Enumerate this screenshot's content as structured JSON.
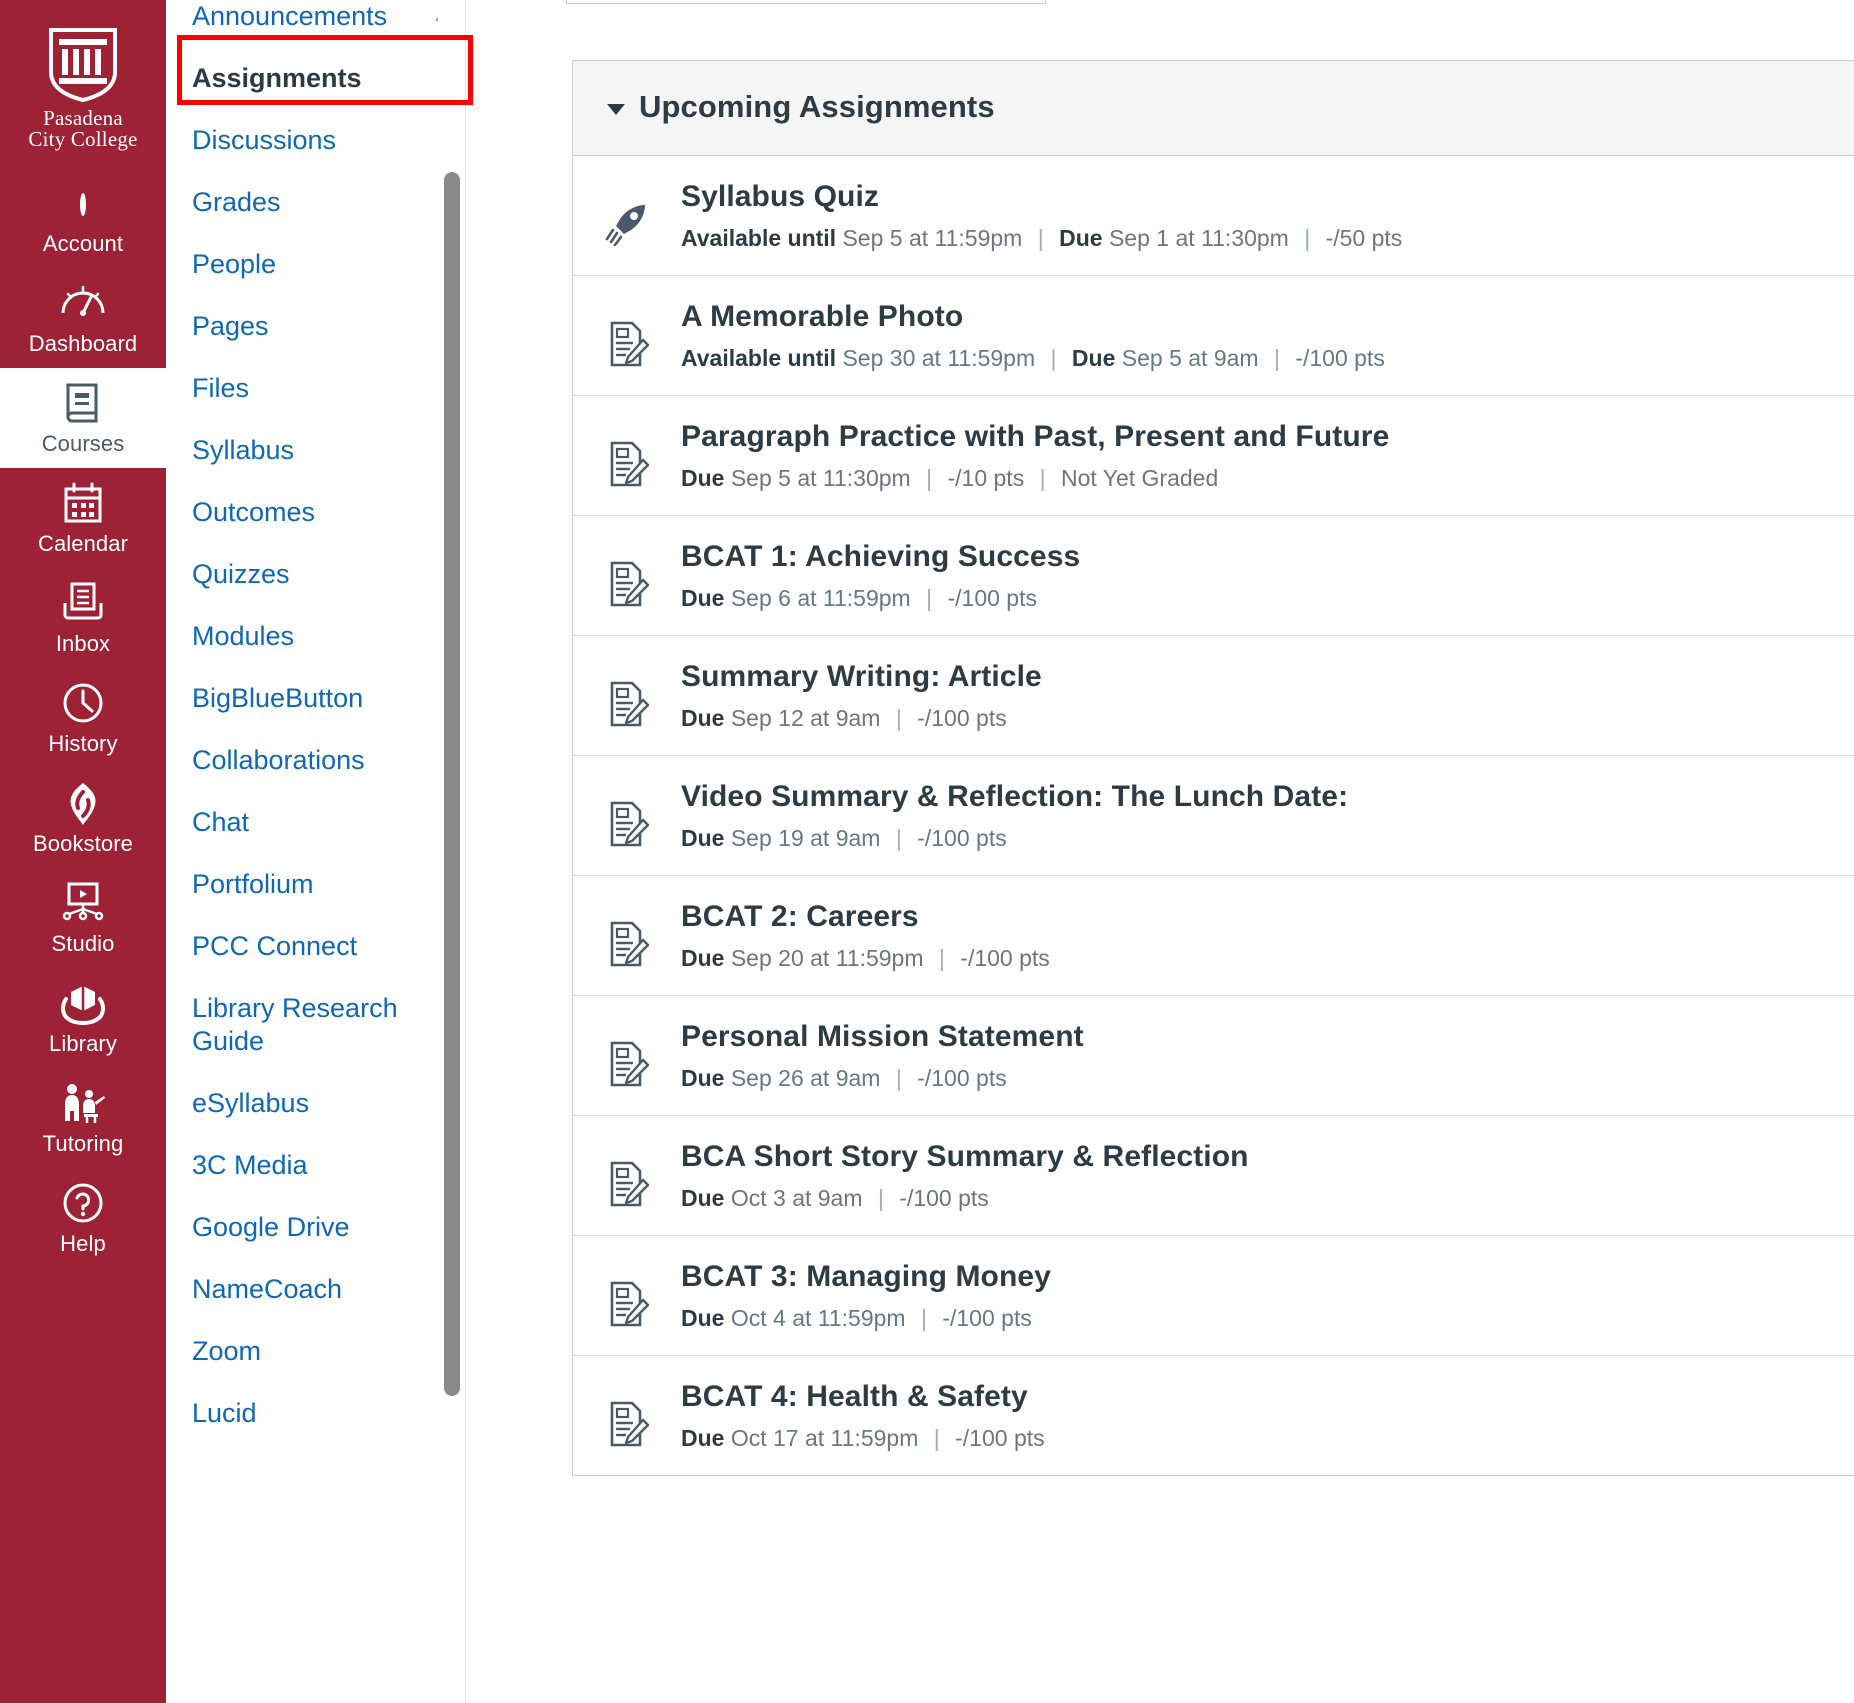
{
  "brand": {
    "logo_icon": "pasadena-city-college-shield-icon",
    "wordmark_line1": "Pasadena",
    "wordmark_line2": "City College"
  },
  "global_nav": {
    "items": [
      {
        "label": "Account",
        "icon": "user-avatar-icon",
        "active": false
      },
      {
        "label": "Dashboard",
        "icon": "dashboard-gauge-icon",
        "active": false
      },
      {
        "label": "Courses",
        "icon": "courses-book-icon",
        "active": true
      },
      {
        "label": "Calendar",
        "icon": "calendar-icon",
        "active": false
      },
      {
        "label": "Inbox",
        "icon": "inbox-tray-icon",
        "active": false
      },
      {
        "label": "History",
        "icon": "clock-history-icon",
        "active": false
      },
      {
        "label": "Bookstore",
        "icon": "bookstore-icon",
        "active": false
      },
      {
        "label": "Studio",
        "icon": "studio-screen-play-icon",
        "active": false
      },
      {
        "label": "Library",
        "icon": "library-hands-book-icon",
        "active": false
      },
      {
        "label": "Tutoring",
        "icon": "tutoring-people-icon",
        "active": false
      },
      {
        "label": "Help",
        "icon": "question-circle-icon",
        "active": false
      }
    ]
  },
  "course_nav": {
    "scroll_up_icon": "chevron-up-icon",
    "items": [
      {
        "label": "Announcements",
        "active": false
      },
      {
        "label": "Assignments",
        "active": true
      },
      {
        "label": "Discussions",
        "active": false
      },
      {
        "label": "Grades",
        "active": false
      },
      {
        "label": "People",
        "active": false
      },
      {
        "label": "Pages",
        "active": false
      },
      {
        "label": "Files",
        "active": false
      },
      {
        "label": "Syllabus",
        "active": false
      },
      {
        "label": "Outcomes",
        "active": false
      },
      {
        "label": "Quizzes",
        "active": false
      },
      {
        "label": "Modules",
        "active": false
      },
      {
        "label": "BigBlueButton",
        "active": false
      },
      {
        "label": "Collaborations",
        "active": false
      },
      {
        "label": "Chat",
        "active": false
      },
      {
        "label": "Portfolium",
        "active": false
      },
      {
        "label": "PCC Connect",
        "active": false
      },
      {
        "label": "Library Research Guide",
        "active": false
      },
      {
        "label": "eSyllabus",
        "active": false
      },
      {
        "label": "3C Media",
        "active": false
      },
      {
        "label": "Google Drive",
        "active": false
      },
      {
        "label": "NameCoach",
        "active": false
      },
      {
        "label": "Zoom",
        "active": false
      },
      {
        "label": "Lucid",
        "active": false
      }
    ]
  },
  "assignment_group": {
    "title": "Upcoming Assignments",
    "collapse_icon": "caret-down-icon",
    "expanded": true
  },
  "assignments": [
    {
      "title": "Syllabus Quiz",
      "icon": "rocket-quiz-icon",
      "available_label": "Available until",
      "available_value": "Sep 5 at 11:59pm",
      "due_label": "Due",
      "due_value": "Sep 1 at 11:30pm",
      "points": "-/50 pts",
      "status": ""
    },
    {
      "title": "A Memorable Photo",
      "icon": "assignment-document-pencil-icon",
      "available_label": "Available until",
      "available_value": "Sep 30 at 11:59pm",
      "due_label": "Due",
      "due_value": "Sep 5 at 9am",
      "points": "-/100 pts",
      "status": ""
    },
    {
      "title": "Paragraph Practice with Past, Present and Future",
      "icon": "assignment-document-pencil-icon",
      "available_label": "",
      "available_value": "",
      "due_label": "Due",
      "due_value": "Sep 5 at 11:30pm",
      "points": "-/10 pts",
      "status": "Not Yet Graded"
    },
    {
      "title": "BCAT 1: Achieving Success",
      "icon": "assignment-document-pencil-icon",
      "available_label": "",
      "available_value": "",
      "due_label": "Due",
      "due_value": "Sep 6 at 11:59pm",
      "points": "-/100 pts",
      "status": ""
    },
    {
      "title": "Summary Writing: Article",
      "icon": "assignment-document-pencil-icon",
      "available_label": "",
      "available_value": "",
      "due_label": "Due",
      "due_value": "Sep 12 at 9am",
      "points": "-/100 pts",
      "status": ""
    },
    {
      "title": "Video Summary & Reflection: The Lunch Date:",
      "icon": "assignment-document-pencil-icon",
      "available_label": "",
      "available_value": "",
      "due_label": "Due",
      "due_value": "Sep 19 at 9am",
      "points": "-/100 pts",
      "status": ""
    },
    {
      "title": "BCAT 2: Careers",
      "icon": "assignment-document-pencil-icon",
      "available_label": "",
      "available_value": "",
      "due_label": "Due",
      "due_value": "Sep 20 at 11:59pm",
      "points": "-/100 pts",
      "status": ""
    },
    {
      "title": "Personal Mission Statement",
      "icon": "assignment-document-pencil-icon",
      "available_label": "",
      "available_value": "",
      "due_label": "Due",
      "due_value": "Sep 26 at 9am",
      "points": "-/100 pts",
      "status": ""
    },
    {
      "title": "BCA Short Story Summary & Reflection",
      "icon": "assignment-document-pencil-icon",
      "available_label": "",
      "available_value": "",
      "due_label": "Due",
      "due_value": "Oct 3 at 9am",
      "points": "-/100 pts",
      "status": ""
    },
    {
      "title": "BCAT 3: Managing Money",
      "icon": "assignment-document-pencil-icon",
      "available_label": "",
      "available_value": "",
      "due_label": "Due",
      "due_value": "Oct 4 at 11:59pm",
      "points": "-/100 pts",
      "status": ""
    },
    {
      "title": "BCAT 4: Health & Safety",
      "icon": "assignment-document-pencil-icon",
      "available_label": "",
      "available_value": "",
      "due_label": "Due",
      "due_value": "Oct 17 at 11:59pm",
      "points": "-/100 pts",
      "status": ""
    }
  ],
  "annotation": {
    "target": "Assignments",
    "color": "#FF0000"
  },
  "colors": {
    "brand_crimson": "#9D2235",
    "link_blue": "#0E68B3",
    "text_dark": "#2D3B45",
    "text_muted": "#6B7780",
    "panel_header_bg": "#F5F5F5",
    "border": "#C7CDD1"
  }
}
